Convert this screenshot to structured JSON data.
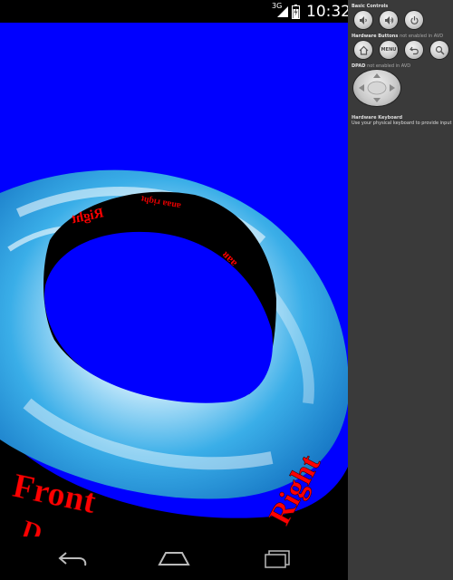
{
  "status_bar": {
    "network_type": "3G",
    "time": "10:32"
  },
  "colors": {
    "app_background": "#0000ff",
    "ring_side_text": "#ff0000"
  },
  "scene": {
    "front_text": "Front",
    "right_text": "Right",
    "inner_text": "Right"
  },
  "nav_bar": {
    "icons": [
      "back-icon",
      "home-icon",
      "recents-icon"
    ]
  },
  "emulator": {
    "basic_controls_title": "Basic Controls",
    "hardware_buttons_title": "Hardware Buttons",
    "hardware_buttons_note": "not enabled in AVD",
    "menu_label": "MENU",
    "dpad_title": "DPAD",
    "dpad_note": "not enabled in AVD",
    "keyboard_title": "Hardware Keyboard",
    "keyboard_note": "Use your physical keyboard to provide input"
  }
}
